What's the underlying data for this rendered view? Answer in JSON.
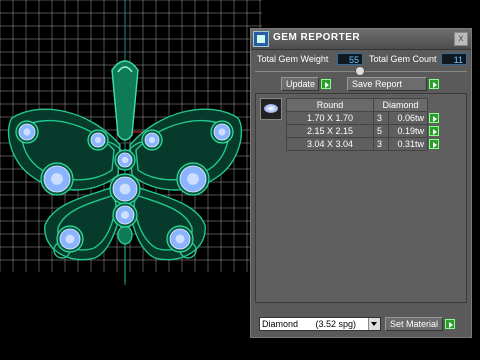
{
  "panel": {
    "title": "GEM REPORTER",
    "close_label": "x",
    "total_gem_weight_label": "Total Gem Weight",
    "total_gem_weight_value": "55",
    "total_gem_count_label": "Total Gem Count",
    "total_gem_count_value": "11",
    "update_label": "Update",
    "save_report_label": "Save Report",
    "table": {
      "headers": [
        "Round",
        "",
        "Diamond"
      ],
      "rows": [
        {
          "size": "1.70 X 1.70",
          "count": "3",
          "weight": "0.06tw"
        },
        {
          "size": "2.15 X 2.15",
          "count": "5",
          "weight": "0.19tw"
        },
        {
          "size": "3.04 X 3.04",
          "count": "3",
          "weight": "0.31tw"
        }
      ]
    },
    "material": "Diamond       (3.52 spg)",
    "set_material_label": "Set Material"
  },
  "colors": {
    "model": "#1aa878",
    "grid": "#e8e8e8",
    "gem": "#8ab4ff",
    "accent_green": "#2c9c2c",
    "value_text": "#6cc8ff"
  },
  "icons": {
    "title": "gem-reporter-app-icon",
    "close": "close-icon",
    "go": "green-arrow-icon",
    "dropdown": "chevron-down-icon",
    "gem_preview": "gem-preview-icon"
  }
}
